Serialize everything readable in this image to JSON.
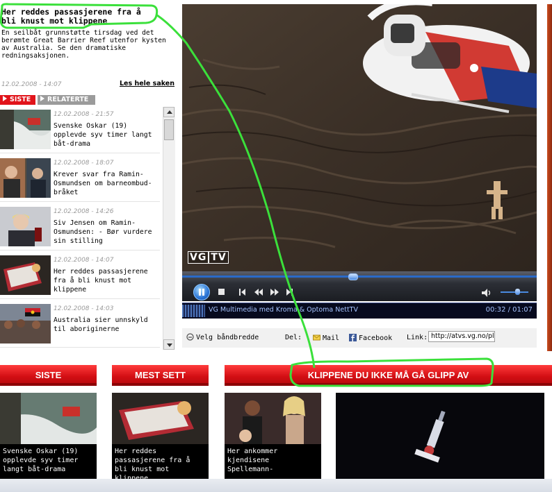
{
  "story": {
    "title": "Her reddes passasjerene fra å bli knust mot klippene",
    "summary": "En seilbåt grunnstøtte tirsdag ved det berømte Great Barrier Reef utenfor kysten av Australia. Se den dramatiske redningsaksjonen.",
    "date": "12.02.2008 - 14:07",
    "read_more": "Les hele saken"
  },
  "tabs": [
    {
      "label": "SISTE",
      "active": true
    },
    {
      "label": "RELATERTE",
      "active": false
    }
  ],
  "list": [
    {
      "date": "12.02.2008 - 21:57",
      "title": "Svenske Oskar (19) opplevde syv timer langt båt-drama"
    },
    {
      "date": "12.02.2008 - 18:07",
      "title": "Krever svar fra Ramin-Osmundsen om barneombud-bråket"
    },
    {
      "date": "12.02.2008 - 14:26",
      "title": "Siv Jensen om Ramin-Osmundsen: - Bør vurdere sin stilling"
    },
    {
      "date": "12.02.2008 - 14:07",
      "title": "Her reddes passasjerene fra å bli knust mot klippene"
    },
    {
      "date": "12.02.2008 - 14:03",
      "title": "Australia sier unnskyld til aboriginerne"
    }
  ],
  "player": {
    "logo": "VG",
    "logo_tv": "TV",
    "status_text": "VG Multimedia med Kroma & Optoma NettTV",
    "time": "00:32 / 01:07",
    "progress_fraction": 0.48,
    "volume_fraction": 0.6
  },
  "share": {
    "bandwidth": "Velg båndbredde",
    "del_label": "Del:",
    "mail": "Mail",
    "facebook": "Facebook",
    "link_label": "Link:",
    "link_value": "http://atvs.vg.no/pla"
  },
  "sections": {
    "siste": "SISTE",
    "mest_sett": "MEST SETT",
    "klippene": "KLIPPENE DU IKKE MÅ GÅ GLIPP AV"
  },
  "cards": [
    {
      "caption": "Svenske Oskar (19) opplevde syv timer langt båt-drama"
    },
    {
      "caption": "Her reddes passasjerene fra å bli knust mot klippene"
    },
    {
      "caption": "Her ankommer kjendisene Spellemann-"
    }
  ],
  "colors": {
    "accent_red": "#e1141b",
    "annotation_green": "#3be03b",
    "player_blue": "#2a6ac8"
  }
}
